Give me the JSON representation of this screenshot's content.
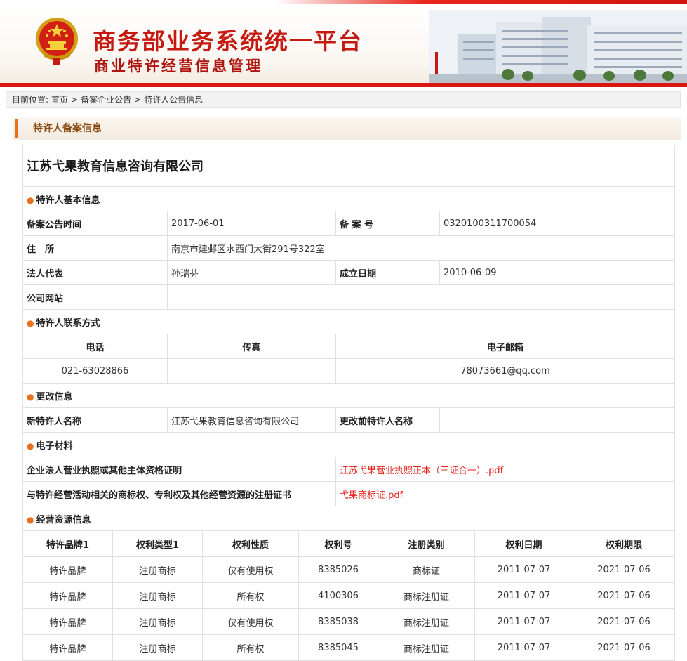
{
  "header": {
    "title": "商务部业务系统统一平台",
    "subtitle": "商业特许经营信息管理"
  },
  "breadcrumb": {
    "prefix": "目前位置:",
    "items": [
      "首页",
      "备案企业公告",
      "特许人公告信息"
    ],
    "separator": ">"
  },
  "panel": {
    "title": "特许人备案信息"
  },
  "company_name": "江苏弋果教育信息咨询有限公司",
  "basic_info": {
    "section": "特许人基本信息",
    "filing_date_label": "备案公告时间",
    "filing_date": "2017-06-01",
    "filing_no_label": "备 案 号",
    "filing_no": "0320100311700054",
    "address_label": "住　所",
    "address": "南京市建邺区水西门大街291号322室",
    "legal_rep_label": "法人代表",
    "legal_rep": "孙瑞芬",
    "founded_label": "成立日期",
    "founded": "2010-06-09",
    "website_label": "公司网站",
    "website": ""
  },
  "contact": {
    "section": "特许人联系方式",
    "phone_label": "电话",
    "fax_label": "传真",
    "email_label": "电子邮箱",
    "phone": "021-63028866",
    "fax": "",
    "email": "78073661@qq.com"
  },
  "change": {
    "section": "更改信息",
    "new_name_label": "新特许人名称",
    "new_name": "江苏弋果教育信息咨询有限公司",
    "old_name_label": "更改前特许人名称",
    "old_name": ""
  },
  "materials": {
    "section": "电子材料",
    "items": [
      {
        "label": "企业法人营业执照或其他主体资格证明",
        "file": "江苏弋果营业执照正本（三证合一）.pdf"
      },
      {
        "label": "与特许经营活动相关的商标权、专利权及其他经营资源的注册证书",
        "file": "弋果商标证.pdf"
      }
    ]
  },
  "resources": {
    "section": "经营资源信息",
    "columns": [
      "特许品牌1",
      "权利类型1",
      "权利性质",
      "权利号",
      "注册类别",
      "权利日期",
      "权利期限"
    ],
    "rows": [
      [
        "特许品牌",
        "注册商标",
        "仅有使用权",
        "8385026",
        "商标证",
        "2011-07-07",
        "2021-07-06"
      ],
      [
        "特许品牌",
        "注册商标",
        "所有权",
        "4100306",
        "商标注册证",
        "2011-07-07",
        "2021-07-06"
      ],
      [
        "特许品牌",
        "注册商标",
        "仅有使用权",
        "8385038",
        "商标注册证",
        "2011-07-07",
        "2021-07-06"
      ],
      [
        "特许品牌",
        "注册商标",
        "所有权",
        "8385045",
        "商标注册证",
        "2011-07-07",
        "2021-07-06"
      ]
    ]
  },
  "colors": {
    "brand_red": "#d9160f",
    "accent_orange": "#e8711d",
    "link_red": "#e4231b"
  }
}
